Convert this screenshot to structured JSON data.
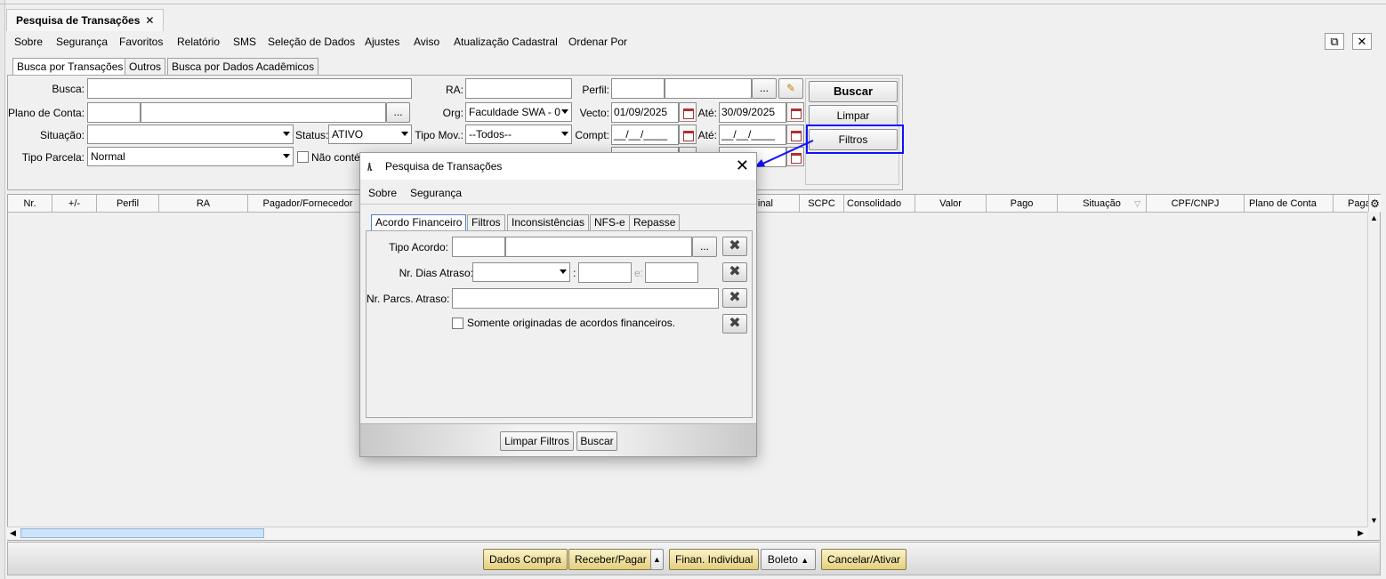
{
  "doc_tab": {
    "title": "Pesquisa de Transações",
    "close": "✕"
  },
  "menu": [
    "Sobre",
    "Segurança",
    "Favoritos",
    "Relatório",
    "SMS",
    "Seleção de Dados",
    "Ajustes",
    "Aviso",
    "Atualização Cadastral",
    "Ordenar Por"
  ],
  "window_buttons": {
    "popout": "⧉",
    "close": "✕"
  },
  "subtabs": [
    "Busca por Transações",
    "Outros",
    "Busca por Dados Acadêmicos"
  ],
  "form": {
    "busca_label": "Busca:",
    "plano_label": "Plano de Conta:",
    "plano_btn": "...",
    "situacao_label": "Situação:",
    "situacao_value": "",
    "tipo_parcela_label": "Tipo Parcela:",
    "tipo_parcela_value": "Normal",
    "status_label": "Status:",
    "status_value": "ATIVO",
    "nao_conte_label": "Não conté",
    "ra_label": "RA:",
    "org_label": "Org:",
    "org_value": "Faculdade SWA - 0",
    "tipo_mov_label": "Tipo Mov.:",
    "tipo_mov_value": "--Todos--",
    "perfil_label": "Perfil:",
    "perfil_btn": "...",
    "vecto_label": "Vecto:",
    "vecto_from": "01/09/2025",
    "ate_label": "Até:",
    "vecto_to": "30/09/2025",
    "compt_label": "Compt:",
    "compt_from": "__/__/____",
    "compt_to": "__/__/____"
  },
  "actions": {
    "buscar": "Buscar",
    "limpar": "Limpar",
    "filtros": "Filtros"
  },
  "grid_columns": [
    "Nr.",
    "+/-",
    "Perfil",
    "RA",
    "Pagador/Fornecedor",
    "inal",
    "SCPC",
    "Consolidado",
    "Valor",
    "Pago",
    "Situação",
    "CPF/CNPJ",
    "Plano de Conta",
    "Paga"
  ],
  "bottom_buttons": [
    "Dados Compra",
    "Receber/Pagar",
    "Finan. Individual",
    "Boleto",
    "Cancelar/Ativar"
  ],
  "dialog": {
    "logo": "/\\.",
    "title": "Pesquisa de Transações",
    "close": "✕",
    "menu": [
      "Sobre",
      "Segurança"
    ],
    "tabs": [
      "Acordo Financeiro",
      "Filtros",
      "Inconsistências",
      "NFS-e",
      "Repasse"
    ],
    "tipo_acordo_label": "Tipo Acordo:",
    "tipo_acordo_btn": "...",
    "dias_atraso_label": "Nr. Dias Atraso:",
    "colon": ":",
    "e_label": "e:",
    "parcs_atraso_label": "Nr. Parcs. Atraso:",
    "somente_label": "Somente originadas de acordos financeiros.",
    "clear_glyph": "✖",
    "limpar_filtros": "Limpar Filtros",
    "buscar": "Buscar"
  }
}
